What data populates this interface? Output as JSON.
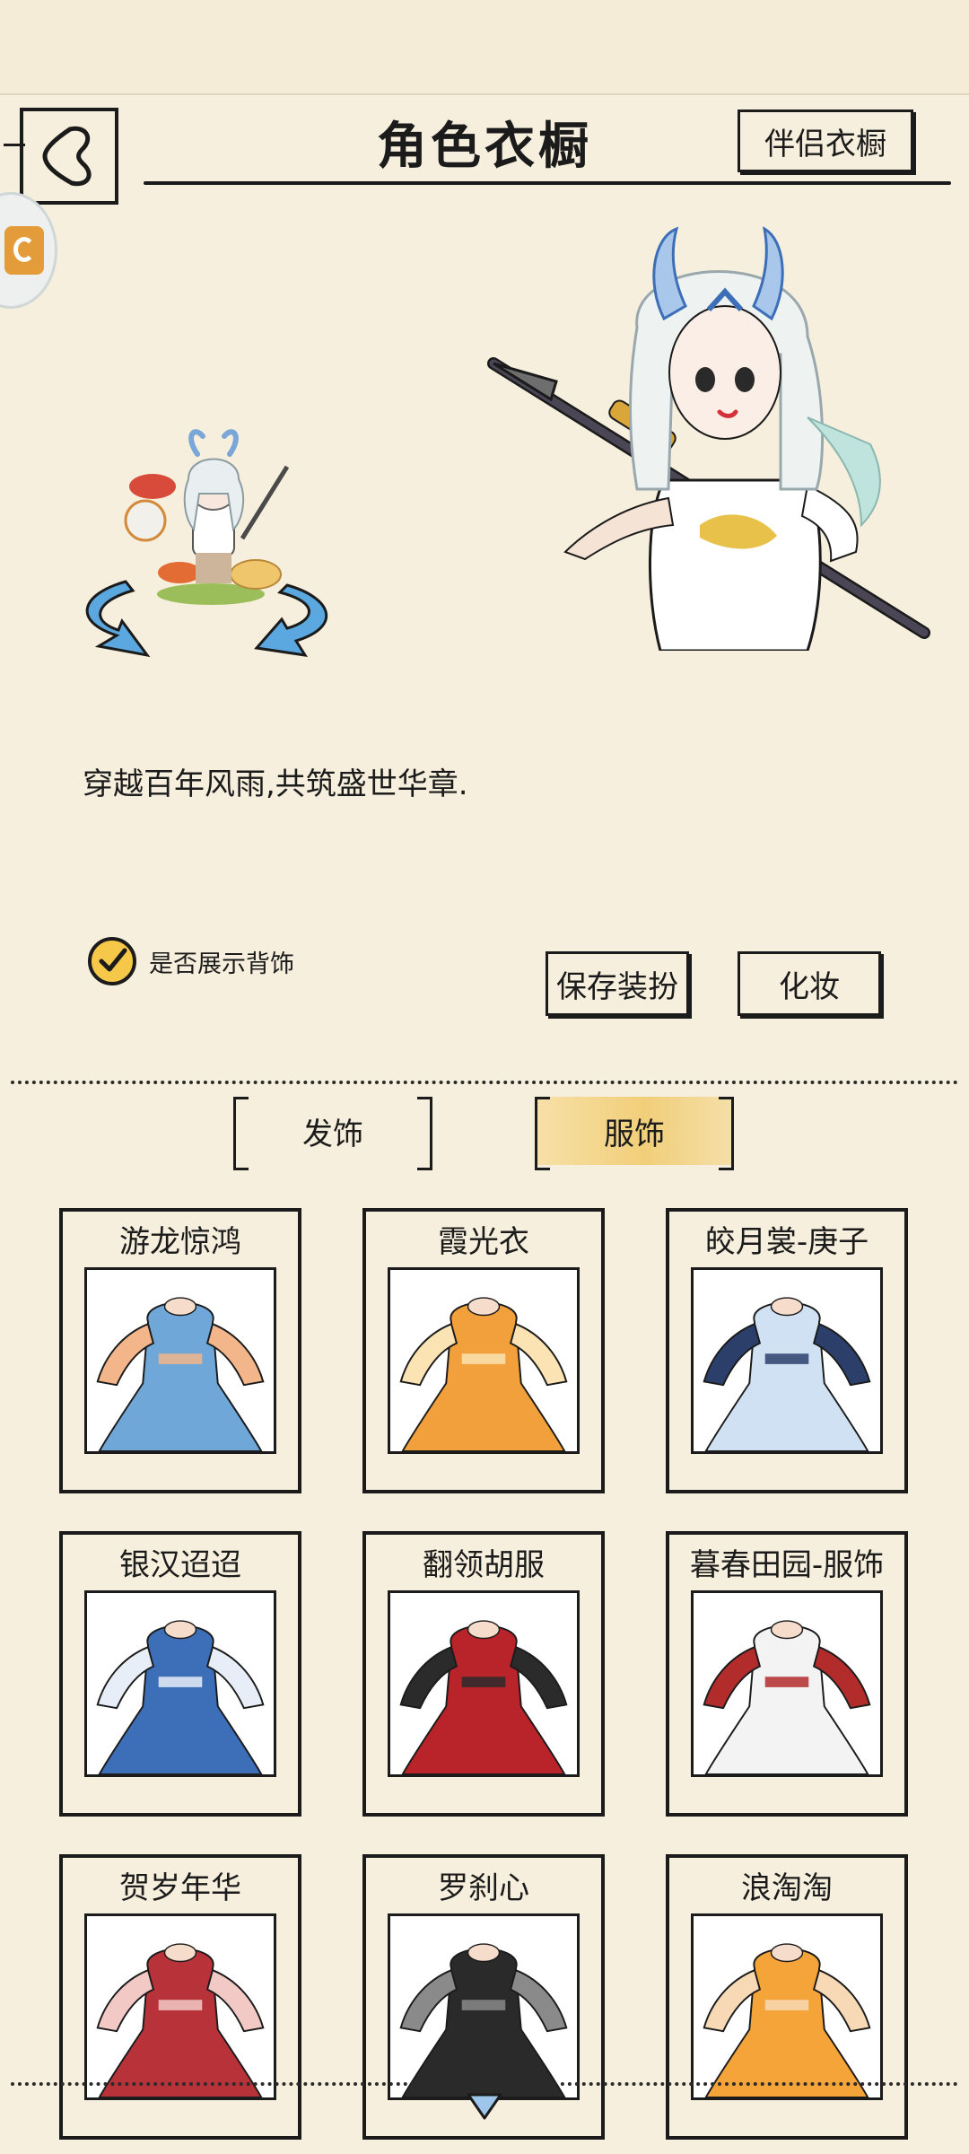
{
  "header": {
    "title": "角色衣橱",
    "partner_wardrobe_label": "伴侣衣橱"
  },
  "preview": {
    "motto": "穿越百年风雨,共筑盛世华章.",
    "show_back_accessory_label": "是否展示背饰",
    "show_back_accessory_checked": true
  },
  "actions": {
    "save_label": "保存装扮",
    "makeup_label": "化妆"
  },
  "tabs": [
    {
      "label": "发饰",
      "selected": false
    },
    {
      "label": "服饰",
      "selected": true
    }
  ],
  "outfits": [
    {
      "name": "游龙惊鸿",
      "color": "#6fa7d8",
      "accent": "#f3b58a"
    },
    {
      "name": "霞光衣",
      "color": "#f1a03b",
      "accent": "#fbe3b4"
    },
    {
      "name": "皎月裳-庚子",
      "color": "#cfe1f3",
      "accent": "#2c3f6b"
    },
    {
      "name": "银汉迢迢",
      "color": "#3d6fb8",
      "accent": "#e7eef7"
    },
    {
      "name": "翻领胡服",
      "color": "#b9232a",
      "accent": "#2b2b2b"
    },
    {
      "name": "暮春田园-服饰",
      "color": "#f3f3f3",
      "accent": "#b22c2c"
    },
    {
      "name": "贺岁年华",
      "color": "#b8323a",
      "accent": "#f2c9c5"
    },
    {
      "name": "罗刹心",
      "color": "#2a2a2a",
      "accent": "#8a8a8a"
    },
    {
      "name": "浪淘淘",
      "color": "#f5a43a",
      "accent": "#f7d9b5"
    }
  ],
  "colors": {
    "background": "#f7efdd",
    "selected_tab": "#f1cf7a",
    "checkbox": "#f6c84a"
  }
}
